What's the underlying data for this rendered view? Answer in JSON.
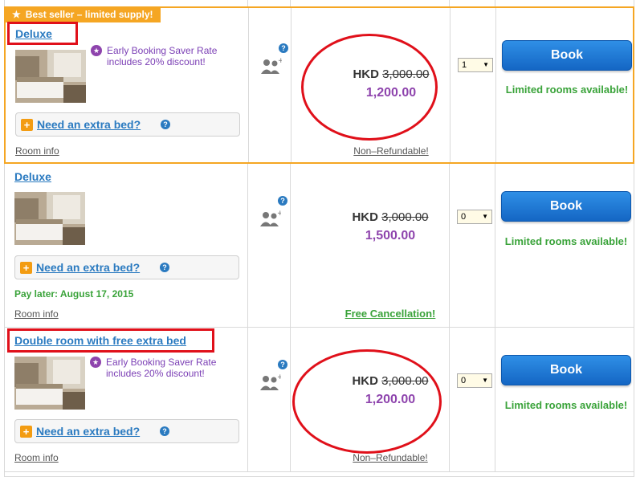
{
  "badge": {
    "icon": "star-icon",
    "label": "Best seller – limited supply!"
  },
  "rooms": [
    {
      "name": "Deluxe",
      "promo": "Early Booking Saver Rate includes 20% discount!",
      "extra_bed": "Need an extra bed?",
      "pay_later": "",
      "room_info": "Room info",
      "currency": "HKD",
      "old_price": "3,000.00",
      "new_price": "1,200.00",
      "policy": "Non–Refundable!",
      "qty": "1",
      "book": "Book",
      "availability": "Limited rooms available!"
    },
    {
      "name": "Deluxe",
      "promo": "",
      "extra_bed": "Need an extra bed?",
      "pay_later": "Pay later: August 17, 2015",
      "room_info": "Room info",
      "currency": "HKD",
      "old_price": "3,000.00",
      "new_price": "1,500.00",
      "policy": "Free Cancellation!",
      "qty": "0",
      "book": "Book",
      "availability": "Limited rooms available!"
    },
    {
      "name": "Double room with free extra bed",
      "promo": "Early Booking Saver Rate includes 20% discount!",
      "extra_bed": "Need an extra bed?",
      "pay_later": "",
      "room_info": "Room info",
      "currency": "HKD",
      "old_price": "3,000.00",
      "new_price": "1,200.00",
      "policy": "Non–Refundable!",
      "qty": "0",
      "book": "Book",
      "availability": "Limited rooms available!"
    }
  ],
  "colors": {
    "accent": "#2a7ac0",
    "promo": "#8e44ad",
    "highlight": "#f5a623",
    "green": "#3aa33a",
    "annotation": "#e0101a"
  }
}
